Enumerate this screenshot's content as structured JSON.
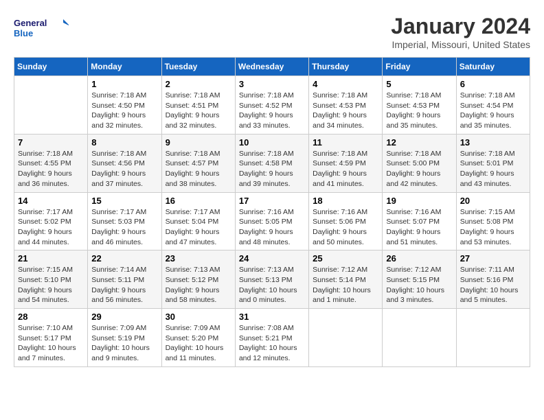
{
  "header": {
    "logo_line1": "General",
    "logo_line2": "Blue",
    "title": "January 2024",
    "subtitle": "Imperial, Missouri, United States"
  },
  "weekdays": [
    "Sunday",
    "Monday",
    "Tuesday",
    "Wednesday",
    "Thursday",
    "Friday",
    "Saturday"
  ],
  "weeks": [
    [
      {
        "day": "",
        "info": ""
      },
      {
        "day": "1",
        "info": "Sunrise: 7:18 AM\nSunset: 4:50 PM\nDaylight: 9 hours\nand 32 minutes."
      },
      {
        "day": "2",
        "info": "Sunrise: 7:18 AM\nSunset: 4:51 PM\nDaylight: 9 hours\nand 32 minutes."
      },
      {
        "day": "3",
        "info": "Sunrise: 7:18 AM\nSunset: 4:52 PM\nDaylight: 9 hours\nand 33 minutes."
      },
      {
        "day": "4",
        "info": "Sunrise: 7:18 AM\nSunset: 4:53 PM\nDaylight: 9 hours\nand 34 minutes."
      },
      {
        "day": "5",
        "info": "Sunrise: 7:18 AM\nSunset: 4:53 PM\nDaylight: 9 hours\nand 35 minutes."
      },
      {
        "day": "6",
        "info": "Sunrise: 7:18 AM\nSunset: 4:54 PM\nDaylight: 9 hours\nand 35 minutes."
      }
    ],
    [
      {
        "day": "7",
        "info": "Sunrise: 7:18 AM\nSunset: 4:55 PM\nDaylight: 9 hours\nand 36 minutes."
      },
      {
        "day": "8",
        "info": "Sunrise: 7:18 AM\nSunset: 4:56 PM\nDaylight: 9 hours\nand 37 minutes."
      },
      {
        "day": "9",
        "info": "Sunrise: 7:18 AM\nSunset: 4:57 PM\nDaylight: 9 hours\nand 38 minutes."
      },
      {
        "day": "10",
        "info": "Sunrise: 7:18 AM\nSunset: 4:58 PM\nDaylight: 9 hours\nand 39 minutes."
      },
      {
        "day": "11",
        "info": "Sunrise: 7:18 AM\nSunset: 4:59 PM\nDaylight: 9 hours\nand 41 minutes."
      },
      {
        "day": "12",
        "info": "Sunrise: 7:18 AM\nSunset: 5:00 PM\nDaylight: 9 hours\nand 42 minutes."
      },
      {
        "day": "13",
        "info": "Sunrise: 7:18 AM\nSunset: 5:01 PM\nDaylight: 9 hours\nand 43 minutes."
      }
    ],
    [
      {
        "day": "14",
        "info": "Sunrise: 7:17 AM\nSunset: 5:02 PM\nDaylight: 9 hours\nand 44 minutes."
      },
      {
        "day": "15",
        "info": "Sunrise: 7:17 AM\nSunset: 5:03 PM\nDaylight: 9 hours\nand 46 minutes."
      },
      {
        "day": "16",
        "info": "Sunrise: 7:17 AM\nSunset: 5:04 PM\nDaylight: 9 hours\nand 47 minutes."
      },
      {
        "day": "17",
        "info": "Sunrise: 7:16 AM\nSunset: 5:05 PM\nDaylight: 9 hours\nand 48 minutes."
      },
      {
        "day": "18",
        "info": "Sunrise: 7:16 AM\nSunset: 5:06 PM\nDaylight: 9 hours\nand 50 minutes."
      },
      {
        "day": "19",
        "info": "Sunrise: 7:16 AM\nSunset: 5:07 PM\nDaylight: 9 hours\nand 51 minutes."
      },
      {
        "day": "20",
        "info": "Sunrise: 7:15 AM\nSunset: 5:08 PM\nDaylight: 9 hours\nand 53 minutes."
      }
    ],
    [
      {
        "day": "21",
        "info": "Sunrise: 7:15 AM\nSunset: 5:10 PM\nDaylight: 9 hours\nand 54 minutes."
      },
      {
        "day": "22",
        "info": "Sunrise: 7:14 AM\nSunset: 5:11 PM\nDaylight: 9 hours\nand 56 minutes."
      },
      {
        "day": "23",
        "info": "Sunrise: 7:13 AM\nSunset: 5:12 PM\nDaylight: 9 hours\nand 58 minutes."
      },
      {
        "day": "24",
        "info": "Sunrise: 7:13 AM\nSunset: 5:13 PM\nDaylight: 10 hours\nand 0 minutes."
      },
      {
        "day": "25",
        "info": "Sunrise: 7:12 AM\nSunset: 5:14 PM\nDaylight: 10 hours\nand 1 minute."
      },
      {
        "day": "26",
        "info": "Sunrise: 7:12 AM\nSunset: 5:15 PM\nDaylight: 10 hours\nand 3 minutes."
      },
      {
        "day": "27",
        "info": "Sunrise: 7:11 AM\nSunset: 5:16 PM\nDaylight: 10 hours\nand 5 minutes."
      }
    ],
    [
      {
        "day": "28",
        "info": "Sunrise: 7:10 AM\nSunset: 5:17 PM\nDaylight: 10 hours\nand 7 minutes."
      },
      {
        "day": "29",
        "info": "Sunrise: 7:09 AM\nSunset: 5:19 PM\nDaylight: 10 hours\nand 9 minutes."
      },
      {
        "day": "30",
        "info": "Sunrise: 7:09 AM\nSunset: 5:20 PM\nDaylight: 10 hours\nand 11 minutes."
      },
      {
        "day": "31",
        "info": "Sunrise: 7:08 AM\nSunset: 5:21 PM\nDaylight: 10 hours\nand 12 minutes."
      },
      {
        "day": "",
        "info": ""
      },
      {
        "day": "",
        "info": ""
      },
      {
        "day": "",
        "info": ""
      }
    ]
  ]
}
